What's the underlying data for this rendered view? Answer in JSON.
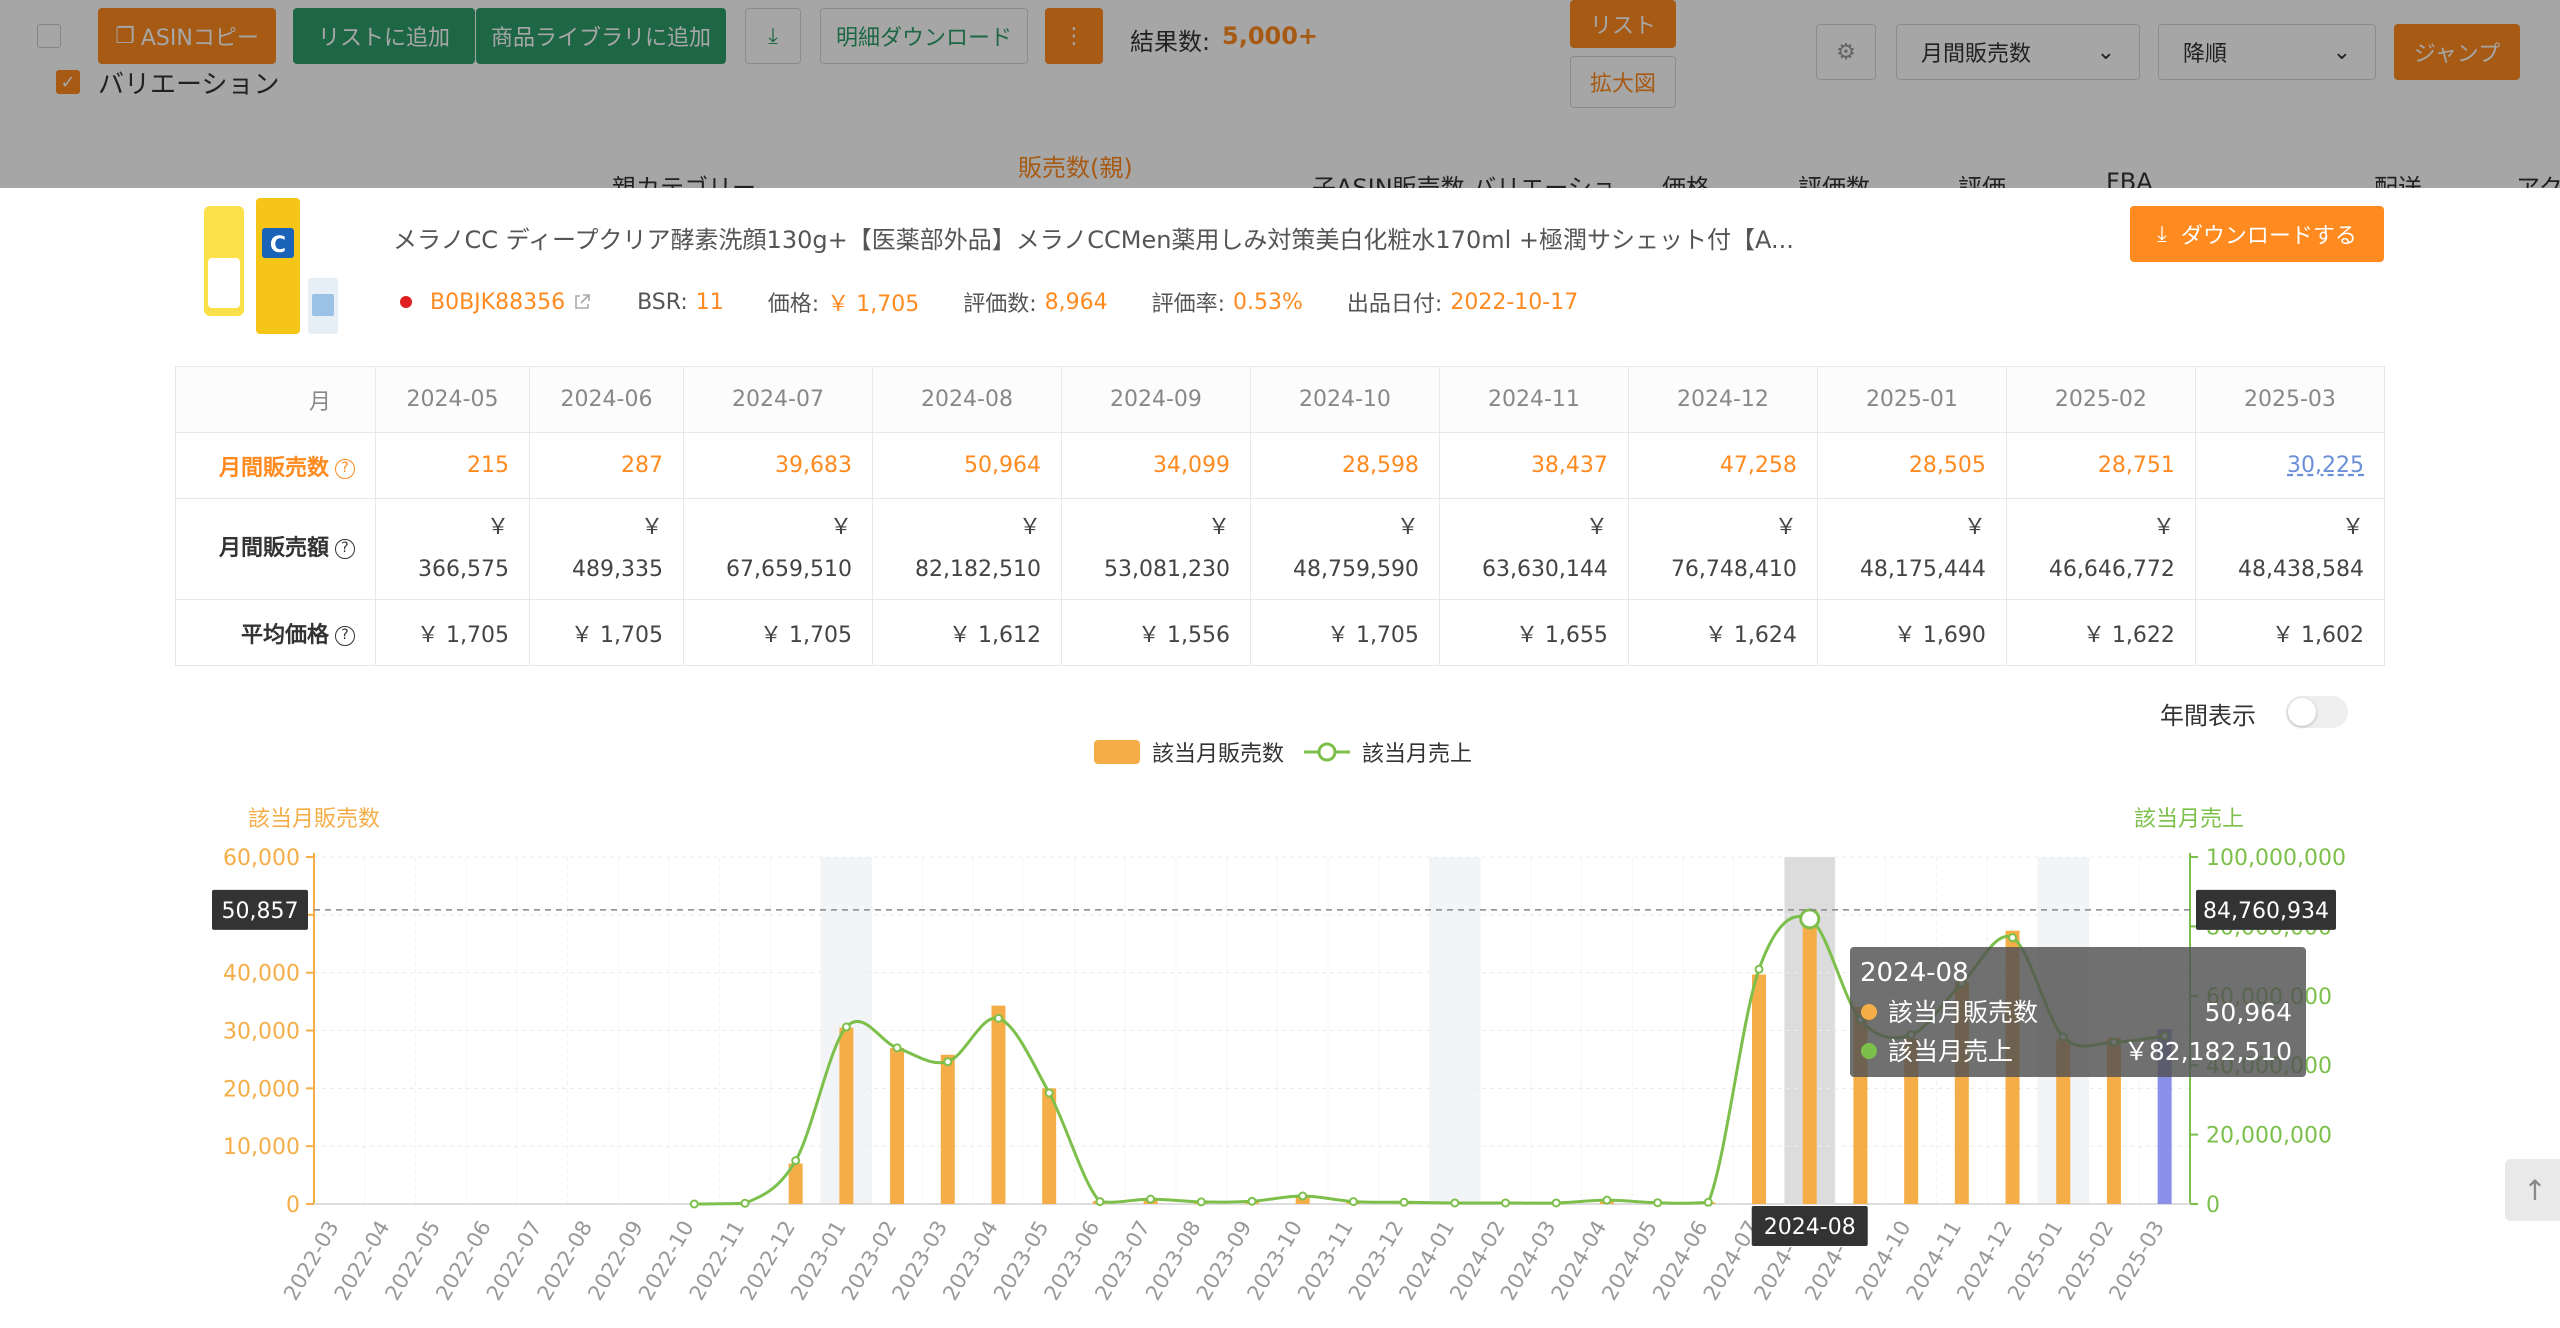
{
  "toolbar": {
    "asin_copy": "ASINコピー",
    "add_to_list": "リストに追加",
    "add_to_library": "商品ライブラリに追加",
    "detail_download": "明細ダウンロード",
    "more": "⋮",
    "result_label": "結果数:",
    "result_value": "5,000+",
    "list_label": "リスト",
    "enlarge_label": "拡大図",
    "sort_field": "月間販売数",
    "sort_order": "降順",
    "jump": "ジャンプ",
    "variation_label": "バリエーション",
    "bg_col_parent_category": "親カテゴリー",
    "bg_col_sales_parent": "販売数(親)",
    "bg_col_child_sales": "子ASIN販売数 バリエーショ",
    "bg_col_price": "価格",
    "bg_col_reviews": "評価数",
    "bg_col_rating": "評価",
    "bg_col_fba": "FBA",
    "bg_col_shipping": "配送",
    "bg_col_action": "アク"
  },
  "product": {
    "title": "メラノCC ディープクリア酵素洗顔130g+【医薬部外品】メラノCCMen薬用しみ対策美白化粧水170ml +極潤サシェット付【A...",
    "asin": "B0BJK88356",
    "bsr_label": "BSR:",
    "bsr": "11",
    "price_label": "価格:",
    "price": "￥ 1,705",
    "reviews_label": "評価数:",
    "reviews": "8,964",
    "rating_rate_label": "評価率:",
    "rating_rate": "0.53%",
    "listed_label": "出品日付:",
    "listed_date": "2022-10-17",
    "download_button": "ダウンロードする"
  },
  "table": {
    "month_header": "月",
    "months": [
      "2024-05",
      "2024-06",
      "2024-07",
      "2024-08",
      "2024-09",
      "2024-10",
      "2024-11",
      "2024-12",
      "2025-01",
      "2025-02",
      "2025-03"
    ],
    "row_count_label": "月間販売数",
    "row_count": [
      "215",
      "287",
      "39,683",
      "50,964",
      "34,099",
      "28,598",
      "38,437",
      "47,258",
      "28,505",
      "28,751",
      "30,225"
    ],
    "row_sales_label": "月間販売額",
    "row_sales": [
      "￥ 366,575",
      "￥ 489,335",
      "￥ 67,659,510",
      "￥ 82,182,510",
      "￥ 53,081,230",
      "￥ 48,759,590",
      "￥ 63,630,144",
      "￥ 76,748,410",
      "￥ 48,175,444",
      "￥ 46,646,772",
      "￥ 48,438,584"
    ],
    "row_price_label": "平均価格",
    "row_price": [
      "￥ 1,705",
      "￥ 1,705",
      "￥ 1,705",
      "￥ 1,612",
      "￥ 1,556",
      "￥ 1,705",
      "￥ 1,655",
      "￥ 1,624",
      "￥ 1,690",
      "￥ 1,622",
      "￥ 1,602"
    ]
  },
  "year_toggle_label": "年間表示",
  "legend": {
    "bar": "該当月販売数",
    "line": "該当月売上"
  },
  "tooltip": {
    "month": "2024-08",
    "count_label": "該当月販売数",
    "count_value": "50,964",
    "sales_label": "該当月売上",
    "sales_value": "￥82,182,510"
  },
  "crosshair": {
    "left_value": "50,857",
    "right_value": "84,760,934",
    "x_value": "2024-08"
  },
  "chart_data": {
    "type": "bar",
    "title": "",
    "ylabel_left": "該当月販売数",
    "ylabel_right": "該当月売上",
    "ylim_left": [
      0,
      60000
    ],
    "ylim_right": [
      0,
      100000000
    ],
    "yticks_left": [
      "0",
      "10,000",
      "20,000",
      "30,000",
      "40,000",
      "50,000",
      "60,000"
    ],
    "yticks_right": [
      "0",
      "20,000,000",
      "40,000,000",
      "60,000,000",
      "80,000,000",
      "100,000,000"
    ],
    "categories": [
      "2022-03",
      "2022-04",
      "2022-05",
      "2022-06",
      "2022-07",
      "2022-08",
      "2022-09",
      "2022-10",
      "2022-11",
      "2022-12",
      "2023-01",
      "2023-02",
      "2023-03",
      "2023-04",
      "2023-05",
      "2023-06",
      "2023-07",
      "2023-08",
      "2023-09",
      "2023-10",
      "2023-11",
      "2023-12",
      "2024-01",
      "2024-02",
      "2024-03",
      "2024-04",
      "2024-05",
      "2024-06",
      "2024-07",
      "2024-08",
      "2024-09",
      "2024-10",
      "2024-11",
      "2024-12",
      "2025-01",
      "2025-02",
      "2025-03"
    ],
    "series": [
      {
        "name": "該当月販売数",
        "type": "bar",
        "color": "#f5ae47",
        "values": [
          0,
          0,
          0,
          0,
          0,
          0,
          0,
          0,
          0,
          7000,
          30500,
          27000,
          25800,
          34300,
          20000,
          500,
          900,
          400,
          500,
          1500,
          500,
          300,
          200,
          200,
          200,
          400,
          215,
          287,
          39683,
          50964,
          34099,
          28598,
          38437,
          47258,
          28505,
          28751,
          30225
        ]
      },
      {
        "name": "該当月売上",
        "type": "line",
        "color": "#7cc04b",
        "values": [
          null,
          null,
          null,
          null,
          null,
          null,
          null,
          0,
          200000,
          12500000,
          51000000,
          45000000,
          41000000,
          53500000,
          32000000,
          700000,
          1400000,
          600000,
          800000,
          2300000,
          700000,
          500000,
          300000,
          300000,
          300000,
          1100000,
          366575,
          489335,
          67659510,
          82182510,
          53081230,
          48759590,
          63630144,
          76748410,
          48175444,
          46646772,
          48438584
        ]
      }
    ],
    "highlight_bands": [
      "2023-01",
      "2024-01",
      "2024-08",
      "2025-01"
    ],
    "active_category": "2024-08",
    "last_bar_color": "#8a8fe8"
  },
  "colors": {
    "accent_orange": "#ff8a1f",
    "bar_orange": "#f5ae47",
    "line_green": "#7cc04b",
    "toolbar_green": "#2e9e6b"
  }
}
